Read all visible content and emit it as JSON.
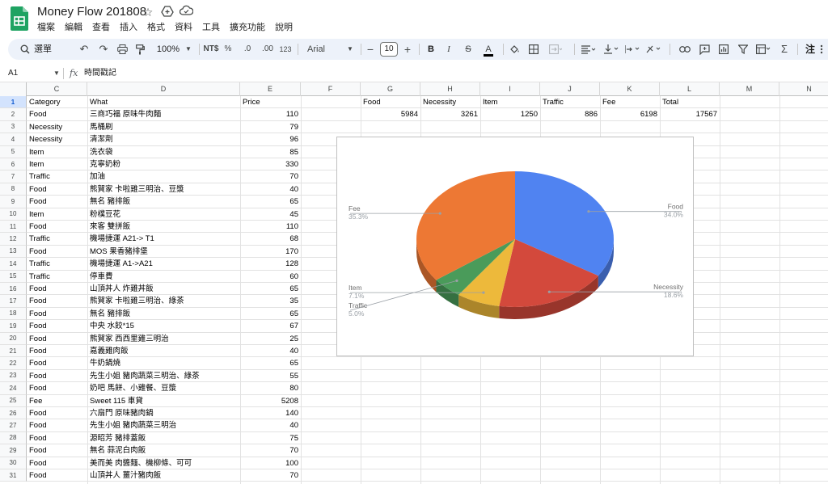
{
  "title_bar": {
    "doc_title": "Money Flow 201808",
    "menus": [
      "檔案",
      "編輯",
      "查看",
      "插入",
      "格式",
      "資料",
      "工具",
      "擴充功能",
      "說明"
    ]
  },
  "toolbar": {
    "search_label": "選單",
    "zoom": "100%",
    "currency": "NT$",
    "percent": "%",
    "dec_decrease": ".0",
    "dec_increase": ".00",
    "number_format": "123",
    "font": "Arial",
    "font_size": "10",
    "bold": "B",
    "italic": "I",
    "text_color": "A",
    "sum": "Σ",
    "comment_mode": "注"
  },
  "formula_bar": {
    "cell_ref": "A1",
    "fx": "fx",
    "content": "時間戳記"
  },
  "columns": [
    "C",
    "D",
    "E",
    "F",
    "G",
    "H",
    "I",
    "J",
    "K",
    "L",
    "M",
    "N"
  ],
  "rows": [
    {
      "n": "1",
      "category": "Category",
      "what": "What",
      "price": ""
    },
    {
      "n": "2",
      "category": "Food",
      "what": "三商巧福 原味牛肉麵",
      "price": "110"
    },
    {
      "n": "3",
      "category": "Necessity",
      "what": "馬桶刷",
      "price": "79"
    },
    {
      "n": "4",
      "category": "Necessity",
      "what": "清潔劑",
      "price": "96"
    },
    {
      "n": "5",
      "category": "Item",
      "what": "洗衣袋",
      "price": "85"
    },
    {
      "n": "6",
      "category": "Item",
      "what": "克寧奶粉",
      "price": "330"
    },
    {
      "n": "7",
      "category": "Traffic",
      "what": "加油",
      "price": "70"
    },
    {
      "n": "8",
      "category": "Food",
      "what": "熊賀家 卡啦雞三明治、豆漿",
      "price": "40"
    },
    {
      "n": "9",
      "category": "Food",
      "what": "無名 豬排飯",
      "price": "65"
    },
    {
      "n": "10",
      "category": "Item",
      "what": "粉樸豆花",
      "price": "45"
    },
    {
      "n": "11",
      "category": "Food",
      "what": "來客 雙拼飯",
      "price": "110"
    },
    {
      "n": "12",
      "category": "Traffic",
      "what": "機場捷運 A21-> T1",
      "price": "68"
    },
    {
      "n": "13",
      "category": "Food",
      "what": "MOS 果香豬排堡",
      "price": "170"
    },
    {
      "n": "14",
      "category": "Traffic",
      "what": "機場捷運 A1->A21",
      "price": "128"
    },
    {
      "n": "15",
      "category": "Traffic",
      "what": "停車費",
      "price": "60"
    },
    {
      "n": "16",
      "category": "Food",
      "what": "山頂丼人 炸雞丼飯",
      "price": "65"
    },
    {
      "n": "17",
      "category": "Food",
      "what": "熊賀家 卡啦雞三明治、綠茶",
      "price": "35"
    },
    {
      "n": "18",
      "category": "Food",
      "what": "無名 豬排飯",
      "price": "65"
    },
    {
      "n": "19",
      "category": "Food",
      "what": "中央 水餃*15",
      "price": "67"
    },
    {
      "n": "20",
      "category": "Food",
      "what": "熊賀家 西西里雞三明治",
      "price": "25"
    },
    {
      "n": "21",
      "category": "Food",
      "what": "嘉義雞肉飯",
      "price": "40"
    },
    {
      "n": "22",
      "category": "Food",
      "what": "牛奶鍋燒",
      "price": "65"
    },
    {
      "n": "23",
      "category": "Food",
      "what": "先生小姐 豬肉蔬菜三明治、綠茶",
      "price": "55"
    },
    {
      "n": "24",
      "category": "Food",
      "what": "奶吧 馬餅、小雞餐、豆漿",
      "price": "80"
    },
    {
      "n": "25",
      "category": "Fee",
      "what": "Sweet 115 車貸",
      "price": "5208"
    },
    {
      "n": "26",
      "category": "Food",
      "what": "六扇門 原味豬肉鍋",
      "price": "140"
    },
    {
      "n": "27",
      "category": "Food",
      "what": "先生小姐 豬肉蔬菜三明治",
      "price": "40"
    },
    {
      "n": "28",
      "category": "Food",
      "what": "源昭芳 豬排蓋飯",
      "price": "75"
    },
    {
      "n": "29",
      "category": "Food",
      "what": "無名 蒜泥白肉飯",
      "price": "70"
    },
    {
      "n": "30",
      "category": "Food",
      "what": "美而美 肉醬麵、機柳條、可可",
      "price": "100"
    },
    {
      "n": "31",
      "category": "Food",
      "what": "山頂丼人 薑汁豬肉飯",
      "price": "70"
    }
  ],
  "price_header": "Price",
  "summary": {
    "headers": [
      "Food",
      "Necessity",
      "Item",
      "Traffic",
      "Fee",
      "Total"
    ],
    "values": [
      "5984",
      "3261",
      "1250",
      "886",
      "6198",
      "17567"
    ]
  },
  "chart_data": {
    "type": "pie",
    "three_d": true,
    "start_angle_deg": 0,
    "slices": [
      {
        "label": "Food",
        "value": 5984,
        "pct": "34.0%",
        "color": "#5083f1"
      },
      {
        "label": "Necessity",
        "value": 3261,
        "pct": "18.6%",
        "color": "#d3493c"
      },
      {
        "label": "Item",
        "value": 1250,
        "pct": "7.1%",
        "color": "#edb93b"
      },
      {
        "label": "Traffic",
        "value": 886,
        "pct": "5.0%",
        "color": "#4a9b5a"
      },
      {
        "label": "Fee",
        "value": 6198,
        "pct": "35.3%",
        "color": "#ed7834"
      }
    ]
  }
}
